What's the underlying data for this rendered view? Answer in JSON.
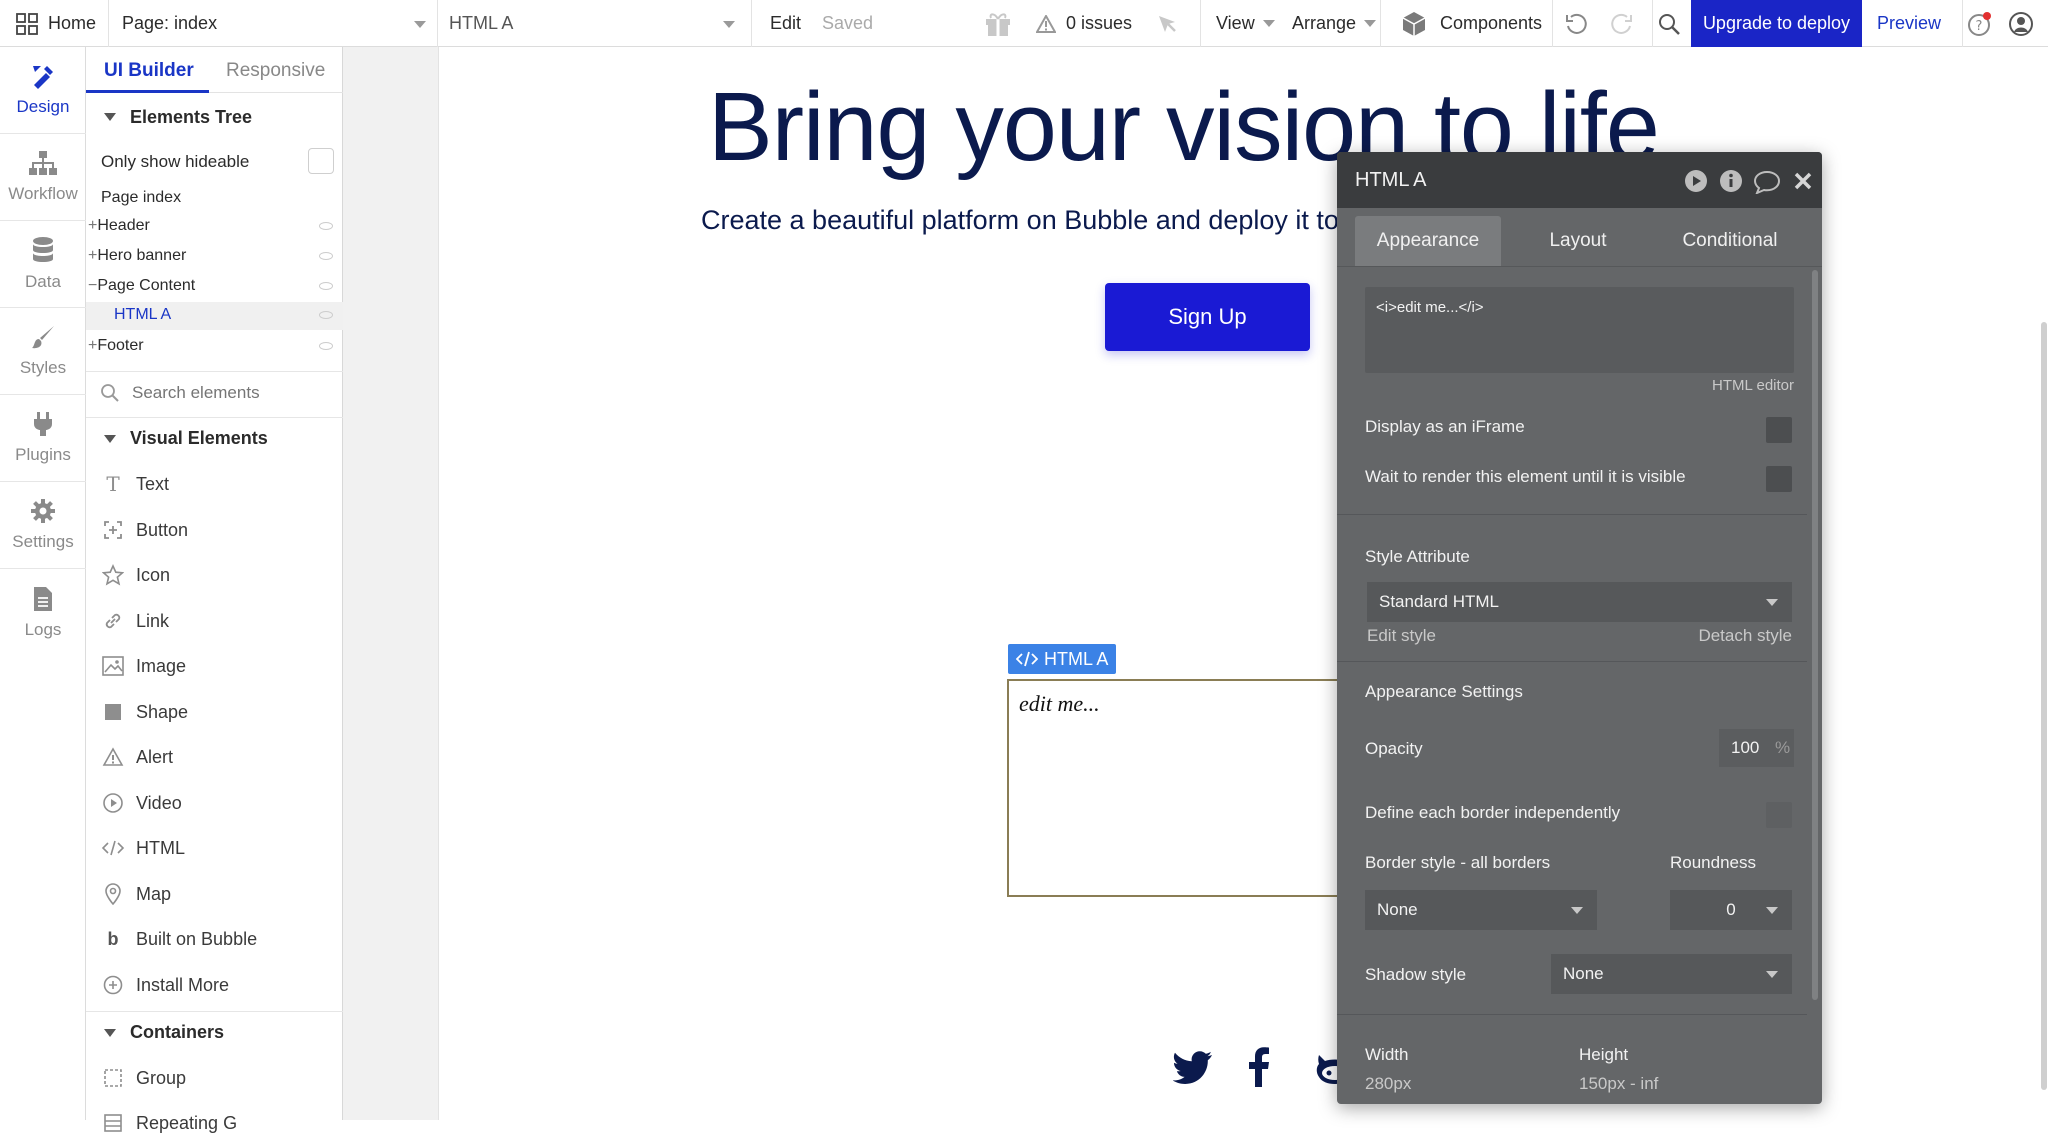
{
  "topbar": {
    "home": "Home",
    "page_label": "Page: index",
    "element_label": "HTML A",
    "edit": "Edit",
    "saved": "Saved",
    "issues": "0 issues",
    "view": "View",
    "arrange": "Arrange",
    "components": "Components",
    "upgrade": "Upgrade to deploy",
    "preview": "Preview"
  },
  "leftnav": [
    {
      "label": "Design",
      "icon": "design-icon"
    },
    {
      "label": "Workflow",
      "icon": "workflow-icon"
    },
    {
      "label": "Data",
      "icon": "data-icon"
    },
    {
      "label": "Styles",
      "icon": "styles-icon"
    },
    {
      "label": "Plugins",
      "icon": "plugins-icon"
    },
    {
      "label": "Settings",
      "icon": "settings-icon"
    },
    {
      "label": "Logs",
      "icon": "logs-icon"
    }
  ],
  "panel": {
    "tab_builder": "UI Builder",
    "tab_responsive": "Responsive",
    "elements_tree": "Elements Tree",
    "only_show_hideable": "Only show hideable",
    "tree": [
      {
        "label": "Page index"
      },
      {
        "label": "Header"
      },
      {
        "label": "Hero banner"
      },
      {
        "label": "Page Content"
      },
      {
        "label": "HTML A"
      },
      {
        "label": "Footer"
      }
    ],
    "search_placeholder": "Search elements",
    "visual_elements": "Visual Elements",
    "visual_items": [
      {
        "label": "Text",
        "icon": "text-icon"
      },
      {
        "label": "Button",
        "icon": "button-icon"
      },
      {
        "label": "Icon",
        "icon": "star-icon"
      },
      {
        "label": "Link",
        "icon": "link-icon"
      },
      {
        "label": "Image",
        "icon": "image-icon"
      },
      {
        "label": "Shape",
        "icon": "shape-icon"
      },
      {
        "label": "Alert",
        "icon": "alert-icon"
      },
      {
        "label": "Video",
        "icon": "video-icon"
      },
      {
        "label": "HTML",
        "icon": "html-icon"
      },
      {
        "label": "Map",
        "icon": "map-pin-icon"
      },
      {
        "label": "Built on Bubble",
        "icon": "bubble-logo-icon"
      },
      {
        "label": "Install More",
        "icon": "plus-circle-icon"
      }
    ],
    "containers": "Containers",
    "container_items": [
      {
        "label": "Group",
        "icon": "group-icon"
      },
      {
        "label": "Repeating G",
        "icon": "repeating-group-icon"
      }
    ]
  },
  "canvas": {
    "hero_title": "Bring your vision to life",
    "hero_subtitle": "Create a beautiful platform on Bubble and deploy it to",
    "signup": "Sign Up",
    "html_tag": "HTML A",
    "html_content": "edit me..."
  },
  "editor": {
    "title": "HTML A",
    "tabs": [
      "Appearance",
      "Layout",
      "Conditional"
    ],
    "html_code": "<i>edit me...</i>",
    "html_editor_link": "HTML editor",
    "display_iframe": "Display as an iFrame",
    "wait_render": "Wait to render this element until it is visible",
    "style_attribute": "Style Attribute",
    "style_value": "Standard HTML",
    "edit_style": "Edit style",
    "detach_style": "Detach style",
    "appearance_settings": "Appearance Settings",
    "opacity_label": "Opacity",
    "opacity_value": "100",
    "opacity_unit": "%",
    "define_border": "Define each border independently",
    "border_style_label": "Border style - all borders",
    "border_style_value": "None",
    "roundness_label": "Roundness",
    "roundness_value": "0",
    "shadow_label": "Shadow style",
    "shadow_value": "None",
    "width_label": "Width",
    "width_value": "280px",
    "height_label": "Height",
    "height_value": "150px - inf"
  },
  "colors": {
    "accent": "#1a36c6",
    "hero_text": "#0b1a4d",
    "editor_bg": "#646668",
    "editor_header": "#3a3c3e",
    "html_tag_bg": "#3b82e6"
  }
}
